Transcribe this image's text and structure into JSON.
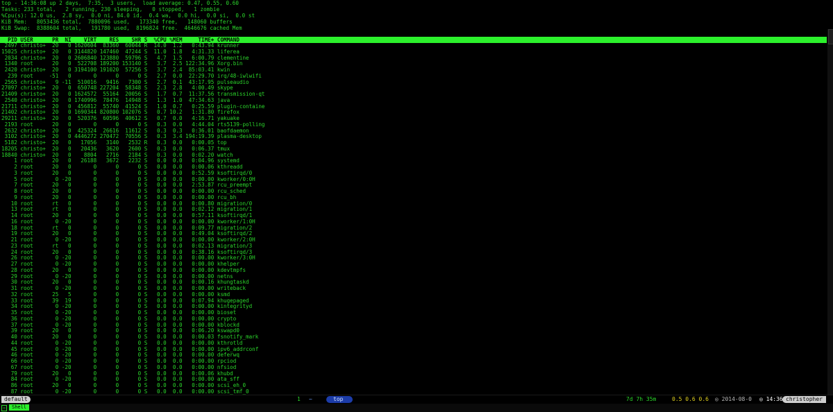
{
  "summary": {
    "l1": "top - 14:36:08 up 2 days,  7:35,  3 users,  load average: 0.47, 0.55, 0.60",
    "l2": "Tasks: 233 total,   2 running, 230 sleeping,   0 stopped,   1 zombie",
    "l3": "%Cpu(s): 12.0 us,  2.8 sy,  0.0 ni, 84.0 id,  0.4 wa,  0.0 hi,  0.0 si,  0.0 st",
    "l4": "KiB Mem:   8053436 total,  7880096 used,   173340 free,   148060 buffers",
    "l5": "KiB Swap:  8388604 total,   191780 used,  8196824 free.  4646676 cached Mem"
  },
  "header": "  PID USER      PR  NI    VIRT    RES    SHR S  %CPU %MEM     TIME+ COMMAND",
  "processes": [
    " 2497 christo+  20   0 1620604  83360  60044 R  14.0  1.2   0:43.94 krunner",
    "15025 christo+  20   0 3144820 147460  47244 S  11.0  1.8   4:31.33 liferea",
    " 2034 christo+  20   0 2606840 123880  59796 S   4.7  1.5   6:00.79 clementine",
    " 1340 root      20   0  522708 189200 153140 S   3.7  2.5 122:34.96 Xorg.bin",
    " 2420 christo+  20   0 3194100 191020  57256 S   3.7  2.4  85:03.41 kwin",
    "  239 root     -51   0       0      0      0 S   2.7  0.0  22:29.70 irq/48-iwlwifi",
    " 2565 christo+   9 -11  510016   9416   7300 S   2.7  0.1  43:17.95 pulseaudio",
    "27097 christo+  20   0  650748 227204  58348 S   2.3  2.8   4:00.49 skype",
    "21409 christo+  20   0 1624572  55164  20056 S   1.7  0.7  11:37.56 transmission-qt",
    " 2540 christo+  20   0 1740996  78476  14948 S   1.3  1.0  47:34.63 java",
    "21711 christo+  20   0  456812  55740  41524 S   1.0  0.7   0:25.59 plugin-containe",
    "21402 christo+  20   0 1690344 820800 102076 S   0.7 10.2   1:31.80 firefox",
    "29211 christo+  20   0  520376  60596  40612 S   0.7  0.0   4:16.71 yakuake",
    " 2193 root      20   0       0      0      0 S   0.3  0.0   4:44.04 rts5139-polling",
    " 2632 christo+  20   0  425324  26616  11612 S   0.3  0.3   0:36.01 baofdaemon",
    " 3102 christo+  20   0 4446272 270472  70556 S   0.3  3.4 194:19.39 plasma-desktop",
    " 5182 christo+  20   0   17056   3140   2532 R   0.3  0.0   0:00.05 top",
    "18205 christo+  20   0   20436   3620   2600 S   0.3  0.0   0:06.37 tmux",
    "18840 christo+  20   0    8804   2716   2184 S   0.3  0.0   0:02.20 watch",
    "    1 root      20   0   26188   3672   2232 S   0.0  0.0   0:04.96 systemd",
    "    2 root      20   0       0      0      0 S   0.0  0.0   0:00.06 kthreadd",
    "    3 root      20   0       0      0      0 S   0.0  0.0   0:52.59 ksoftirqd/0",
    "    5 root       0 -20       0      0      0 S   0.0  0.0   0:00.00 kworker/0:0H",
    "    7 root      20   0       0      0      0 S   0.0  0.0   2:53.87 rcu_preempt",
    "    8 root      20   0       0      0      0 S   0.0  0.0   0:00.00 rcu_sched",
    "    9 root      20   0       0      0      0 S   0.0  0.0   0:00.00 rcu_bh",
    "   10 root      rt   0       0      0      0 S   0.0  0.0   0:00.80 migration/0",
    "   13 root      rt   0       0      0      0 S   0.0  0.0   0:02.12 migration/1",
    "   14 root      20   0       0      0      0 S   0.0  0.0   0:57.11 ksoftirqd/1",
    "   16 root       0 -20       0      0      0 S   0.0  0.0   0:00.00 kworker/1:0H",
    "   18 root      rt   0       0      0      0 S   0.0  0.0   0:09.77 migration/2",
    "   19 root      20   0       0      0      0 S   0.0  0.0   0:49.04 ksoftirqd/2",
    "   21 root       0 -20       0      0      0 S   0.0  0.0   0:00.00 kworker/2:0H",
    "   23 root      rt   0       0      0      0 S   0.0  0.0   0:02.13 migration/3",
    "   24 root      20   0       0      0      0 S   0.0  0.0   0:38.16 ksoftirqd/3",
    "   26 root       0 -20       0      0      0 S   0.0  0.0   0:00.00 kworker/3:0H",
    "   27 root       0 -20       0      0      0 S   0.0  0.0   0:00.00 khelper",
    "   28 root      20   0       0      0      0 S   0.0  0.0   0:00.00 kdevtmpfs",
    "   29 root       0 -20       0      0      0 S   0.0  0.0   0:00.00 netns",
    "   30 root      20   0       0      0      0 S   0.0  0.0   0:00.16 khungtaskd",
    "   31 root       0 -20       0      0      0 S   0.0  0.0   0:00.00 writeback",
    "   32 root      25   5       0      0      0 S   0.0  0.0   0:00.00 ksmd",
    "   33 root      39  19       0      0      0 S   0.0  0.0   0:07.94 khugepaged",
    "   34 root       0 -20       0      0      0 S   0.0  0.0   0:00.00 kintegrityd",
    "   35 root       0 -20       0      0      0 S   0.0  0.0   0:00.00 bioset",
    "   36 root       0 -20       0      0      0 S   0.0  0.0   0:00.00 crypto",
    "   37 root       0 -20       0      0      0 S   0.0  0.0   0:00.00 kblockd",
    "   39 root      20   0       0      0      0 S   0.0  0.0   0:06.20 kswapd0",
    "   40 root      20   0       0      0      0 S   0.0  0.0   0:00.03 fsnotify_mark",
    "   44 root       0 -20       0      0      0 S   0.0  0.0   0:00.00 kthrotld",
    "   45 root       0 -20       0      0      0 S   0.0  0.0   0:00.00 ipv6_addrconf",
    "   46 root       0 -20       0      0      0 S   0.0  0.0   0:00.00 deferwq",
    "   66 root       0 -20       0      0      0 S   0.0  0.0   0:00.00 rpciod",
    "   67 root       0 -20       0      0      0 S   0.0  0.0   0:00.00 nfsiod",
    "   79 root      20   0       0      0      0 S   0.0  0.0   0:00.06 khubd",
    "   84 root       0 -20       0      0      0 S   0.0  0.0   0:00.00 ata_sff",
    "   86 root      20   0       0      0      0 S   0.0  0.0   0:00.00 scsi_eh_0",
    "   87 root       0 -20       0      0      0 S   0.0  0.0   0:00.00 scsi_tmf_0"
  ],
  "statusbar": {
    "session": "default",
    "window_number": "1",
    "window_indicator": "~",
    "window_name": "top",
    "uptime": "7d 7h 35m",
    "load": "0.5 0.6 0.6",
    "date": "2014-08-0",
    "time": "14:36",
    "user": "christopher"
  },
  "bottombar": {
    "shell_tab": "Shell"
  },
  "colors": {
    "text": "#2bd62b",
    "header_bg": "#2cf02c",
    "window_tab": "#1c3ca8",
    "load": "#e0d020"
  }
}
